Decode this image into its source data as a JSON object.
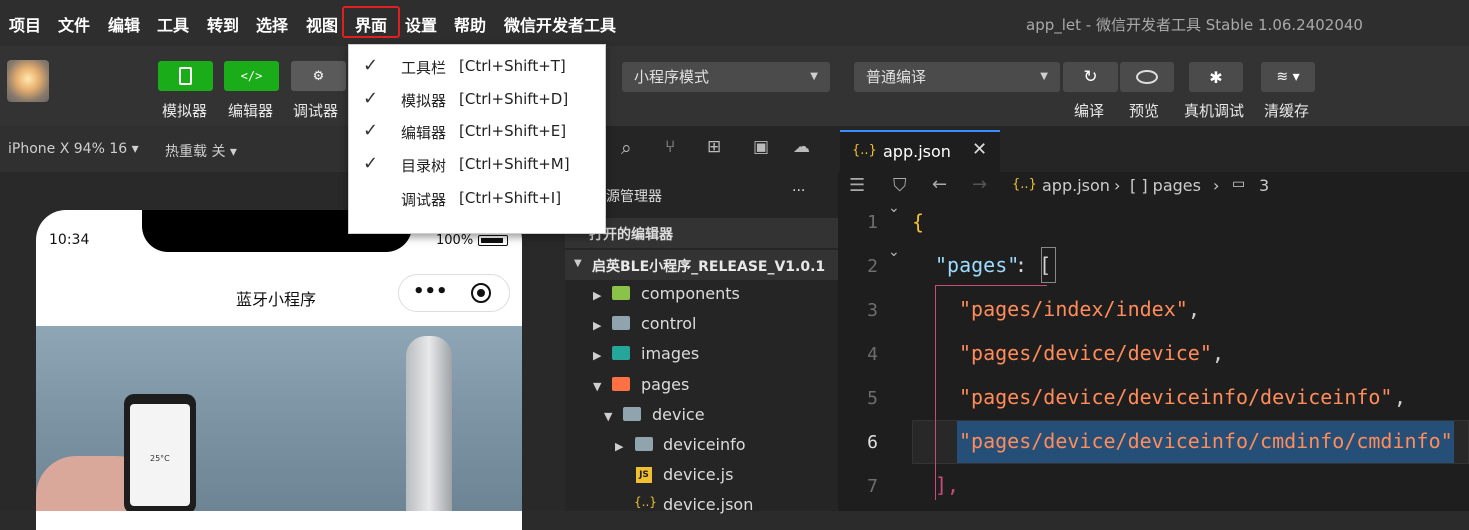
{
  "menubar": {
    "items": [
      "项目",
      "文件",
      "编辑",
      "工具",
      "转到",
      "选择",
      "视图",
      "界面",
      "设置",
      "帮助",
      "微信开发者工具"
    ],
    "window_title": "app_let - 微信开发者工具 Stable 1.06.2402040"
  },
  "toolbar": {
    "simulator_label": "模拟器",
    "editor_label": "编辑器",
    "debugger_label": "调试器",
    "mode_select": "小程序模式",
    "compile_select": "普通编译",
    "compile_label": "编译",
    "preview_label": "预览",
    "remote_debug_label": "真机调试",
    "clear_cache_label": "清缓存"
  },
  "subbar": {
    "device": "iPhone X 94% 16",
    "hot_reload": "热重载 关"
  },
  "phone": {
    "time": "10:34",
    "battery": "100%",
    "title": "蓝牙小程序",
    "capsule_dots": "•••",
    "device_temp": "25°C"
  },
  "view_menu": {
    "items": [
      {
        "checked": true,
        "label": "工具栏",
        "shortcut": "[Ctrl+Shift+T]"
      },
      {
        "checked": true,
        "label": "模拟器",
        "shortcut": "[Ctrl+Shift+D]"
      },
      {
        "checked": true,
        "label": "编辑器",
        "shortcut": "[Ctrl+Shift+E]"
      },
      {
        "checked": true,
        "label": "目录树",
        "shortcut": "[Ctrl+Shift+M]"
      },
      {
        "checked": false,
        "label": "调试器",
        "shortcut": "[Ctrl+Shift+I]"
      }
    ]
  },
  "explorer": {
    "title": "源管理器",
    "more": "···",
    "open_editors": "打开的编辑器",
    "project": "启英BLE小程序_RELEASE_V1.0.1",
    "tree": [
      "components",
      "control",
      "images",
      "pages",
      "device",
      "deviceinfo",
      "device.js",
      "device.json"
    ]
  },
  "editor": {
    "tab_label": "app.json",
    "breadcrumb": {
      "file": "app.json",
      "seg2": "[ ] pages",
      "seg3": "3"
    },
    "line_numbers": [
      "1",
      "2",
      "3",
      "4",
      "5",
      "6",
      "7"
    ],
    "lines": {
      "l1": "{",
      "l2_key": "\"pages\"",
      "l2_rest": ": [",
      "l3": "\"pages/index/index\"",
      "l4": "\"pages/device/device\"",
      "l5": "\"pages/device/deviceinfo/deviceinfo\"",
      "l6": "\"pages/device/deviceinfo/cmdinfo/cmdinfo\"",
      "l7": "],"
    }
  },
  "colors": {
    "accent_green": "#1aad19",
    "highlight_red": "#e02020",
    "string_orange": "#ff8c5a"
  }
}
